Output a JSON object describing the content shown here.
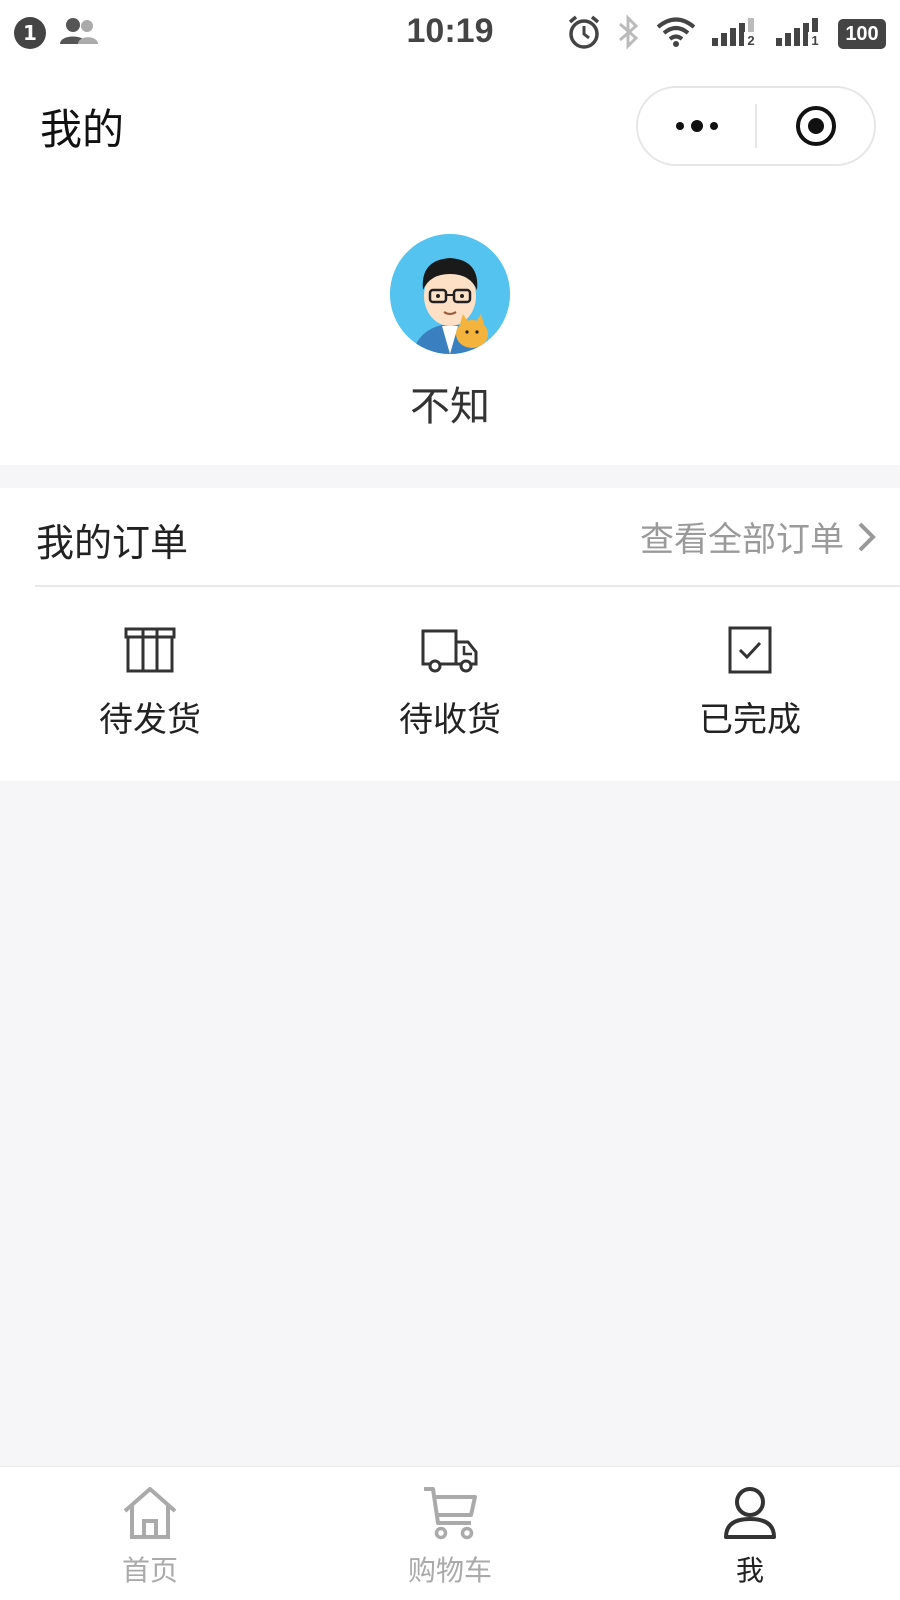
{
  "status_bar": {
    "notification_count": "1",
    "time": "10:19",
    "battery": "100"
  },
  "nav": {
    "title": "我的"
  },
  "profile": {
    "nickname": "不知"
  },
  "orders": {
    "title": "我的订单",
    "view_all_label": "查看全部订单",
    "statuses": [
      {
        "label": "待发货",
        "icon": "box-icon"
      },
      {
        "label": "待收货",
        "icon": "truck-icon"
      },
      {
        "label": "已完成",
        "icon": "check-square-icon"
      }
    ]
  },
  "tabbar": {
    "items": [
      {
        "label": "首页",
        "icon": "home-icon",
        "active": false
      },
      {
        "label": "购物车",
        "icon": "cart-icon",
        "active": false
      },
      {
        "label": "我",
        "icon": "user-icon",
        "active": true
      }
    ]
  },
  "colors": {
    "page_background": "#f6f6f8",
    "card_background": "#ffffff",
    "text_primary": "#222222",
    "text_muted": "#9a9a9a",
    "tab_inactive": "#aaaaaa",
    "tab_active": "#222222",
    "avatar_bg": "#55c3f0"
  }
}
